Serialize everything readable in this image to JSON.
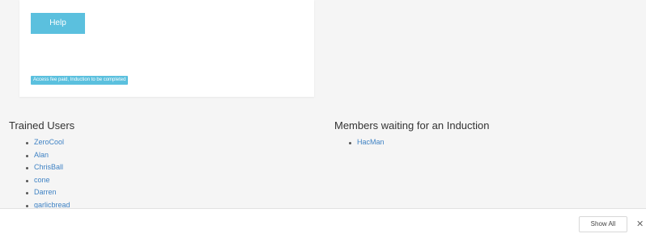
{
  "card": {
    "help_label": "Help",
    "status_label": "Access fee paid, Induction to be completed"
  },
  "trained_users": {
    "heading": "Trained Users",
    "items": [
      "ZeroCool",
      "Alan",
      "ChrisBall",
      "cone",
      "Darren",
      "garlicbread"
    ]
  },
  "waiting_members": {
    "heading": "Members waiting for an Induction",
    "items": [
      "HacMan"
    ]
  },
  "bottom_bar": {
    "show_all_label": "Show All",
    "close_glyph": "✕"
  },
  "colors": {
    "accent": "#5bc0de",
    "link": "#3f82c4",
    "background": "#f5f5f5"
  }
}
